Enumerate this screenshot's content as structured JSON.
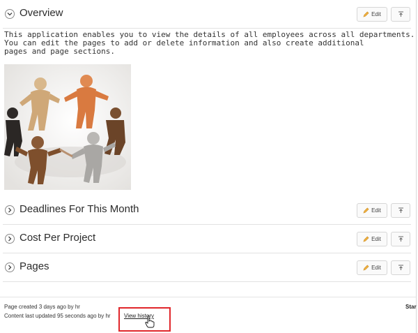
{
  "sections": [
    {
      "title": "Overview",
      "edit_label": "Edit",
      "expanded": true
    },
    {
      "title": "Deadlines For This Month",
      "edit_label": "Edit",
      "expanded": false
    },
    {
      "title": "Cost Per Project",
      "edit_label": "Edit",
      "expanded": false
    },
    {
      "title": "Pages",
      "edit_label": "Edit",
      "expanded": false
    }
  ],
  "overview": {
    "description": "This application enables you to view the details of all employees across all departments.\nYou can edit the pages to add or delete information and also create additional\npages and page sections."
  },
  "footer": {
    "created_text": "Page created 3 days ago by hr",
    "updated_text": "Content last updated 95 seconds ago by hr",
    "history_link": "View history",
    "right_label": "Star"
  },
  "colors": {
    "highlight": "#e0262b",
    "accent_edit": "#e0a020"
  },
  "icons": {
    "collapse": "chevron-down-icon",
    "expand": "chevron-right-icon",
    "edit": "pencil-icon",
    "pin": "pin-top-icon",
    "cursor": "hand-pointer-icon"
  }
}
